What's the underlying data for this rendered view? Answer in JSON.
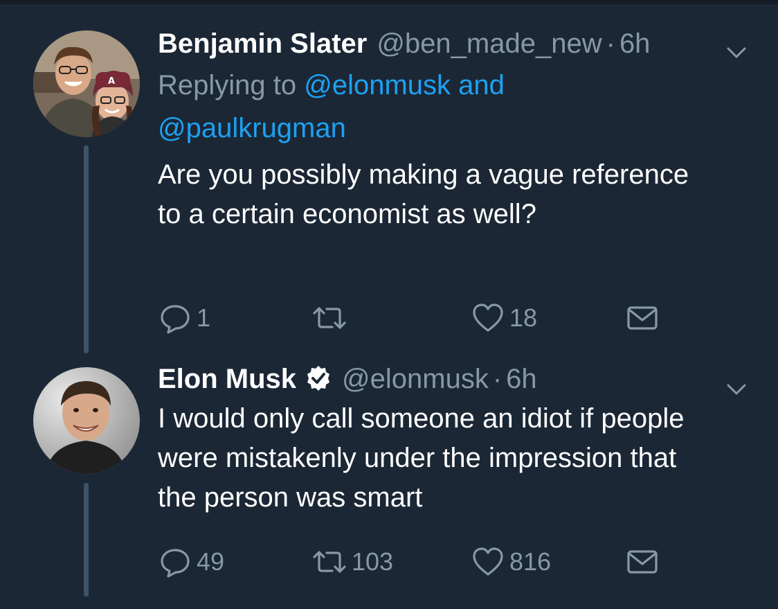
{
  "tweets": [
    {
      "author_name": "Benjamin Slater",
      "handle": "@ben_made_new",
      "separator": "·",
      "time": "6h",
      "verified": false,
      "replying_prefix": "Replying to ",
      "replying_mention_1": "@elonmusk",
      "replying_and": " and",
      "replying_mention_2": "@paulkrugman",
      "text": "Are you possibly making a vague reference to a certain economist as well?",
      "replies": "1",
      "retweets": "",
      "likes": "18",
      "icons": [
        "reply-icon",
        "retweet-icon",
        "like-icon",
        "direct-message-icon",
        "chevron-down-icon"
      ]
    },
    {
      "author_name": "Elon Musk",
      "handle": "@elonmusk",
      "separator": "·",
      "time": "6h",
      "verified": true,
      "text": "I would only call someone an idiot if people were mistakenly under the impression that the person was smart",
      "replies": "49",
      "retweets": "103",
      "likes": "816",
      "icons": [
        "reply-icon",
        "retweet-icon",
        "like-icon",
        "direct-message-icon",
        "chevron-down-icon",
        "verified-badge-icon"
      ]
    }
  ],
  "colors": {
    "background": "#1b2735",
    "name": "#ffffff",
    "muted": "#8899a6",
    "link": "#1da1f2",
    "thread_line": "#3d5466"
  }
}
